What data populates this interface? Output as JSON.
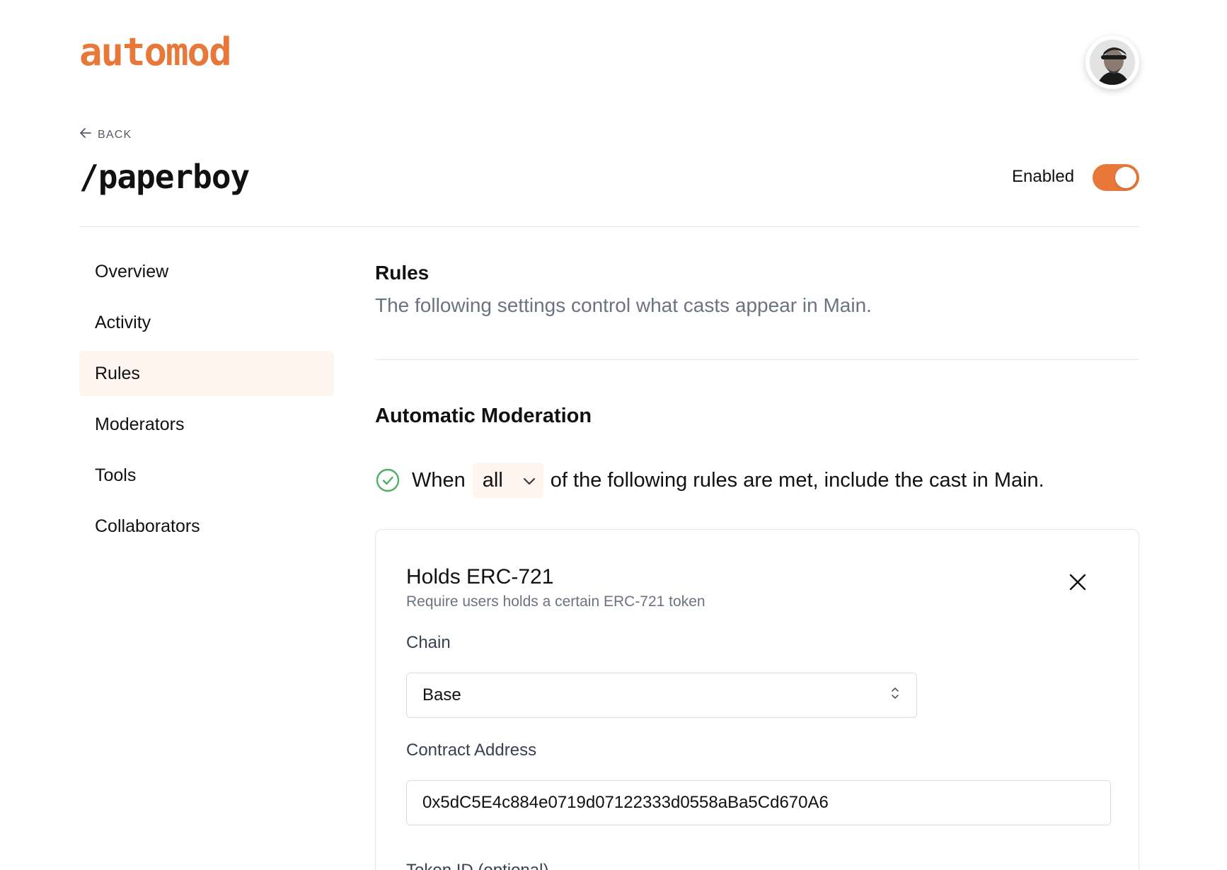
{
  "header": {
    "logo_text": "automod",
    "avatar_label": "user-avatar"
  },
  "page": {
    "back_label": "BACK",
    "title": "/paperboy",
    "enabled_label": "Enabled",
    "enabled": true
  },
  "sidebar": {
    "items": [
      {
        "label": "Overview",
        "active": false
      },
      {
        "label": "Activity",
        "active": false
      },
      {
        "label": "Rules",
        "active": true
      },
      {
        "label": "Moderators",
        "active": false
      },
      {
        "label": "Tools",
        "active": false
      },
      {
        "label": "Collaborators",
        "active": false
      }
    ]
  },
  "rules": {
    "title": "Rules",
    "description": "The following settings control what casts appear in Main.",
    "auto_title": "Automatic Moderation",
    "when_prefix": "When",
    "match_mode": "all",
    "when_suffix": "of the following rules are met, include the cast in Main."
  },
  "rule_card": {
    "title": "Holds ERC-721",
    "subtitle": "Require users holds a certain ERC-721 token",
    "chain_label": "Chain",
    "chain_value": "Base",
    "contract_label": "Contract Address",
    "contract_value": "0x5dC5E4c884e0719d07122333d0558aBa5Cd670A6",
    "token_label": "Token ID (optional)"
  },
  "colors": {
    "accent": "#e8783a",
    "active_bg": "#fdf5ee",
    "success": "#4caf62",
    "muted": "#6b7280"
  }
}
